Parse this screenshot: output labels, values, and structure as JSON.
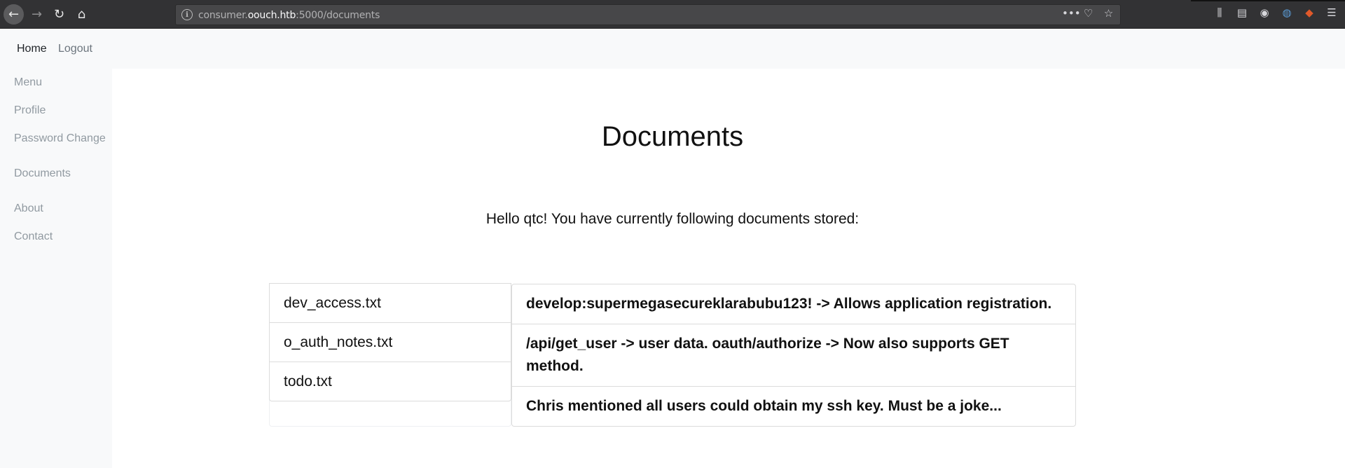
{
  "browser": {
    "url_prefix": "consumer.",
    "url_host": "oouch.htb",
    "url_suffix": ":5000/documents"
  },
  "nav": {
    "home": "Home",
    "logout": "Logout"
  },
  "sidebar": {
    "items": [
      {
        "label": "Menu"
      },
      {
        "label": "Profile"
      },
      {
        "label": "Password Change"
      },
      {
        "label": "Documents"
      },
      {
        "label": "About"
      },
      {
        "label": "Contact"
      }
    ]
  },
  "main": {
    "title": "Documents",
    "greeting": "Hello qtc! You have currently following documents stored:"
  },
  "documents": {
    "names": [
      "dev_access.txt",
      "o_auth_notes.txt",
      "todo.txt"
    ],
    "contents": [
      "develop:supermegasecureklarabubu123! -> Allows application registration.",
      "/api/get_user -> user data. oauth/authorize -> Now also supports GET method.",
      "Chris mentioned all users could obtain my ssh key. Must be a joke..."
    ]
  }
}
